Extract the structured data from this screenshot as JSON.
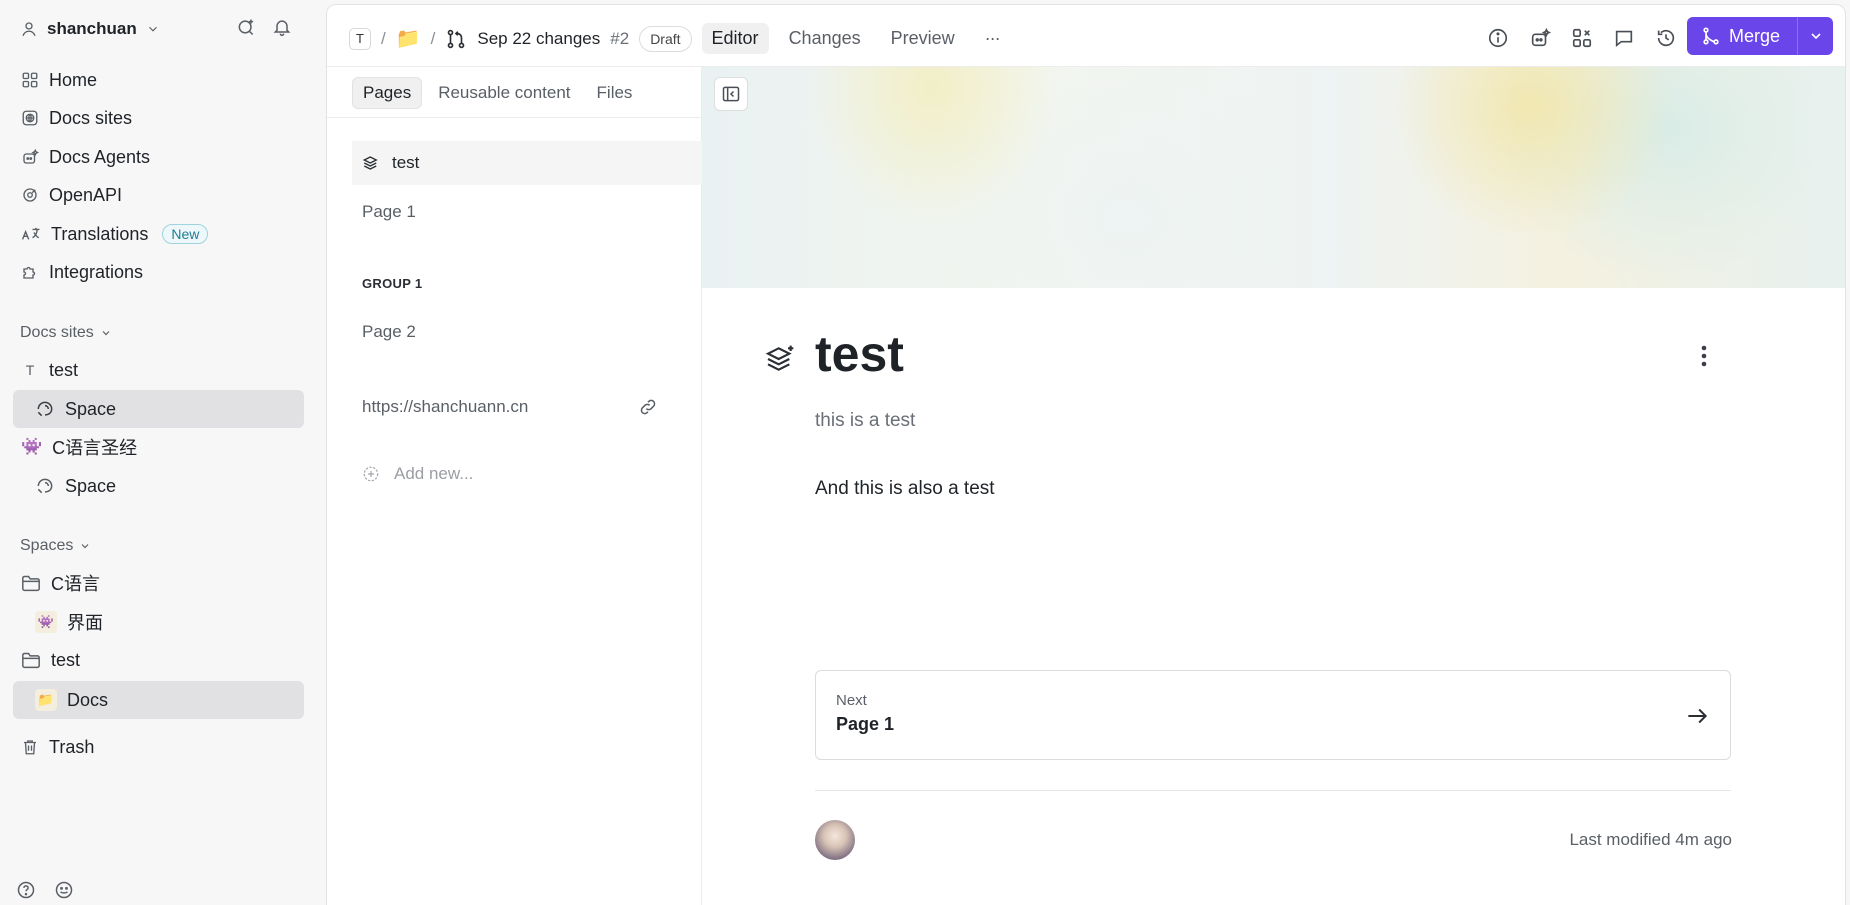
{
  "sidebar": {
    "account": "shanchuan",
    "nav": [
      {
        "label": "Home",
        "icon": "grid-icon"
      },
      {
        "label": "Docs sites",
        "icon": "globe-icon"
      },
      {
        "label": "Docs Agents",
        "icon": "agent-icon"
      },
      {
        "label": "OpenAPI",
        "icon": "openapi-icon"
      },
      {
        "label": "Translations",
        "icon": "translate-icon",
        "badge": "New"
      },
      {
        "label": "Integrations",
        "icon": "puzzle-icon"
      }
    ],
    "docs_sites_heading": "Docs sites",
    "docs_sites": [
      {
        "label": "test",
        "icon_letter": "T"
      },
      {
        "label": "Space",
        "selected": true
      },
      {
        "label": "C语言圣经",
        "emoji": "👾"
      },
      {
        "label": "Space"
      }
    ],
    "spaces_heading": "Spaces",
    "spaces": [
      {
        "label": "C语言"
      },
      {
        "label": "界面",
        "emoji": "👾"
      },
      {
        "label": "test"
      },
      {
        "label": "Docs",
        "emoji": "📁",
        "selected": true
      }
    ],
    "trash": "Trash"
  },
  "topbar": {
    "breadcrumb_letter": "T",
    "breadcrumb_folder_emoji": "📁",
    "separator": "/",
    "change_request_title": "Sep 22 changes",
    "change_request_number": "#2",
    "status": "Draft",
    "tabs": [
      "Editor",
      "Changes",
      "Preview"
    ],
    "active_tab": "Editor",
    "more": "···",
    "merge_label": "Merge",
    "accent": "#6a45e9"
  },
  "pages_panel": {
    "tabs": [
      "Pages",
      "Reusable content",
      "Files"
    ],
    "active_tab": "Pages",
    "items": [
      {
        "label": "test",
        "selected": true
      },
      {
        "label": "Page 1"
      }
    ],
    "group_label": "GROUP 1",
    "group_items": [
      {
        "label": "Page 2"
      }
    ],
    "link": "https://shanchuann.cn",
    "add_new": "Add new..."
  },
  "document": {
    "title": "test",
    "description": "this is a test",
    "body": "And this is also a test",
    "next_label": "Next",
    "next_page": "Page 1",
    "last_modified": "Last modified 4m ago"
  }
}
